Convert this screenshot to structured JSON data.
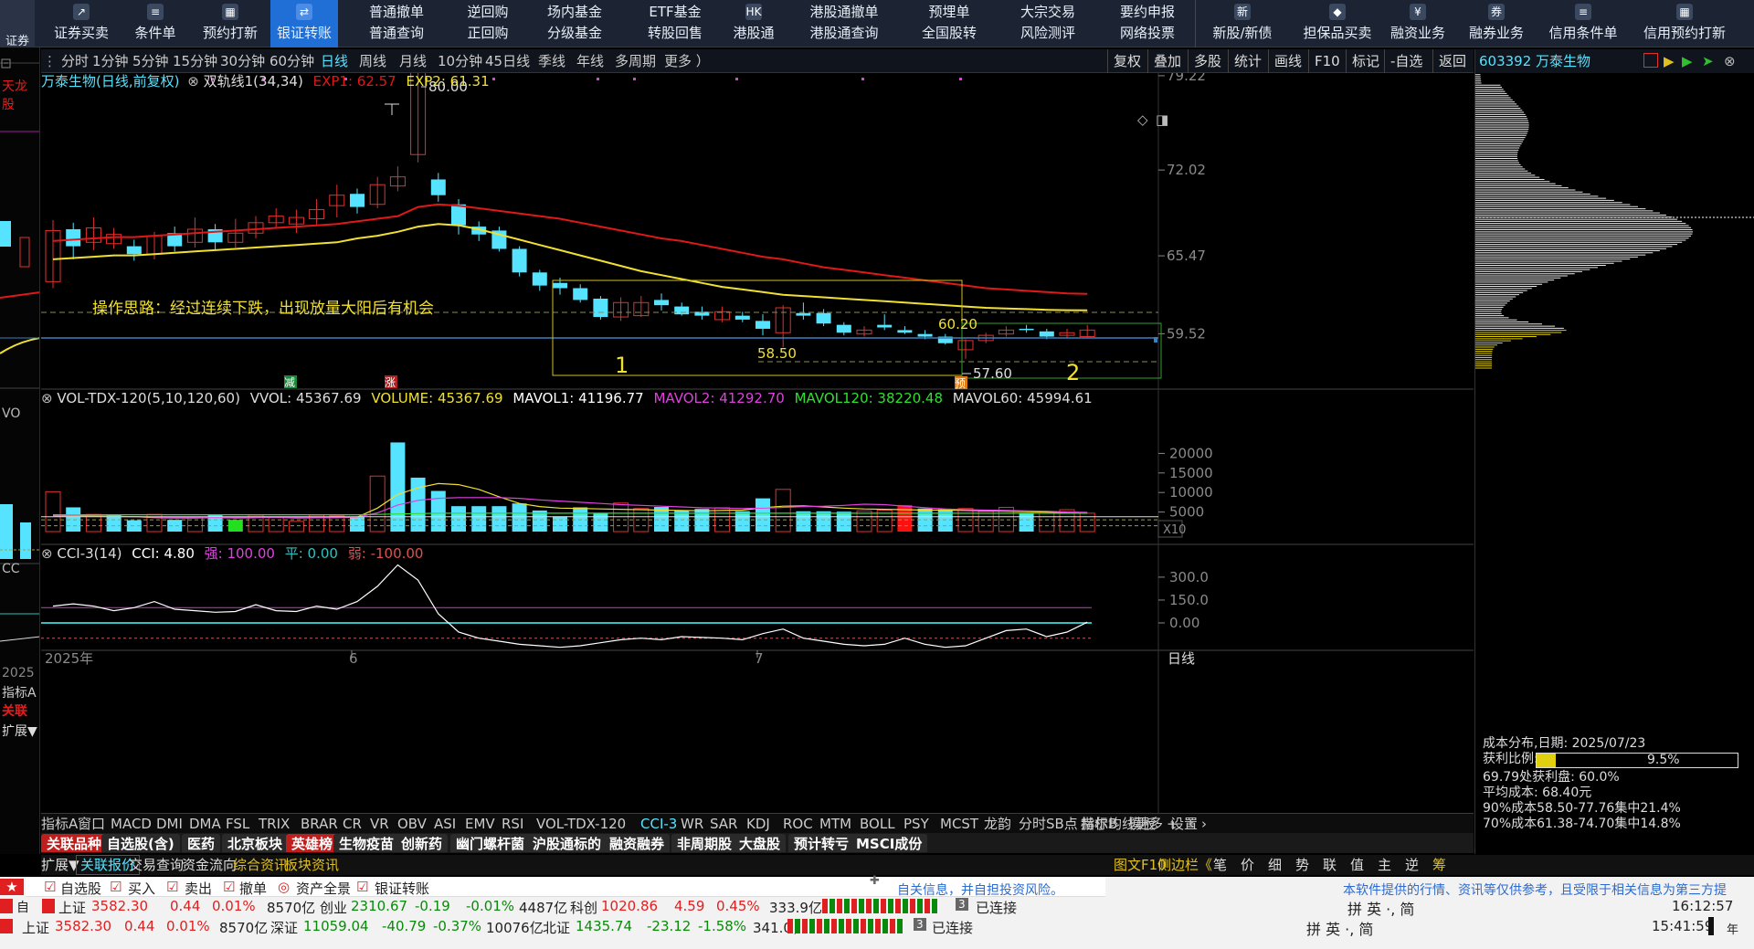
{
  "toolbar": {
    "left_buttons": [
      {
        "label": "证券买卖",
        "icon": "chart-icon"
      },
      {
        "label": "条件单",
        "icon": "order-icon"
      },
      {
        "label": "预约打新",
        "icon": "calendar-icon"
      },
      {
        "label": "银证转账",
        "icon": "transfer-icon"
      }
    ],
    "mid_pairs": [
      [
        "普通撤单",
        "普通查询"
      ],
      [
        "逆回购",
        "正回购"
      ],
      [
        "场内基金",
        "分级基金"
      ],
      [
        "ETF基金",
        "转股回售"
      ],
      [
        "港股通撤单",
        "港股通查询"
      ],
      [
        "预埋单",
        "全国股转"
      ],
      [
        "大宗交易",
        "风险测评"
      ],
      [
        "要约申报",
        "网络投票"
      ]
    ],
    "hk_label": "港股通",
    "right_buttons": [
      {
        "label": "新股/新债"
      },
      {
        "label": "担保品买卖"
      },
      {
        "label": "融资业务"
      },
      {
        "label": "融券业务"
      },
      {
        "label": "信用条件单"
      },
      {
        "label": "信用预约打新"
      }
    ]
  },
  "periods": [
    "分时",
    "1分钟",
    "5分钟",
    "15分钟",
    "30分钟",
    "60分钟",
    "日线",
    "周线",
    "月线",
    "10分钟",
    "45日线",
    "季线",
    "年线",
    "多周期",
    "更多 ）"
  ],
  "period_selected": "日线",
  "actions": [
    "复权",
    "叠加",
    "多股",
    "统计",
    "画线",
    "F10",
    "标记",
    "-自选",
    "返回"
  ],
  "left_strip": [
    "证券",
    "天龙股",
    "VO",
    "CC",
    "2025",
    "指标A",
    "关联",
    "扩展▼",
    "自"
  ],
  "main_chart": {
    "title": "万泰生物(日线,前复权)",
    "indicator": "双轨线1(34,34)",
    "exp1": "EXP1: 62.57",
    "exp2": "EXP2: 61.31",
    "y_ticks": [
      "79.22",
      "72.02",
      "65.47",
      "59.52"
    ],
    "annotation": "操作思路：经过连续下跌，出现放量大阳后有机会",
    "box1_label": "1",
    "box2_label": "2",
    "high_label": "80.00",
    "low_label": "57.60",
    "label_5850": "58.50",
    "label_6020": "60.20",
    "tag_jian": "减",
    "tag_zhang": "涨",
    "tag_yu": "预"
  },
  "volume_panel": {
    "title": "VOL-TDX-120(5,10,120,60)",
    "vvol": "VVOL: 45367.69",
    "volume": "VOLUME: 45367.69",
    "mavol1": "MAVOL1: 41196.77",
    "mavol2": "MAVOL2: 41292.70",
    "mavol120": "MAVOL120: 38220.48",
    "mavol60": "MAVOL60: 45994.61",
    "y_ticks": [
      "20000",
      "15000",
      "10000",
      "5000"
    ],
    "unit": "X10"
  },
  "cci_panel": {
    "title": "CCI-3(14)",
    "cci": "CCI: 4.80",
    "strong": "强: 100.00",
    "flat": "平: 0.00",
    "weak": "弱: -100.00",
    "y_ticks": [
      "300.0",
      "150.0",
      "0.00"
    ]
  },
  "date_axis": [
    "2025年",
    "6",
    "7"
  ],
  "date_axis_unit": "日线",
  "indicator_tabs": [
    "指标A",
    "窗口",
    "MACD",
    "DMI",
    "DMA",
    "FSL",
    "TRIX",
    "BRAR",
    "CR",
    "VR",
    "OBV",
    "ASI",
    "EMV",
    "RSI",
    "VOL-TDX-120",
    "CCI-3",
    "WR",
    "SAR",
    "KDJ",
    "ROC",
    "MTM",
    "BOLL",
    "PSY",
    "MCST",
    "龙韵",
    "分时SB点",
    "赫尔均线",
    "更多",
    "设置",
    "指标B",
    "模板"
  ],
  "indicator_selected": "CCI-3",
  "sector_tabs": [
    "关联品种",
    "自选股(含)",
    "医药",
    "北京板块",
    "英雄榜",
    "生物疫苗",
    "创新药",
    "幽门螺杆菌",
    "沪股通标的",
    "融资融券",
    "非周期股",
    "大盘股",
    "预计转亏",
    "MSCI成份"
  ],
  "footer_tabs": [
    "扩展▼",
    "关联报价",
    "交易查询",
    "资金流向",
    "综合资讯",
    "板块资讯"
  ],
  "footer_right": [
    "图文F10",
    "侧边栏《",
    "笔",
    "价",
    "细",
    "势",
    "联",
    "值",
    "主",
    "逆",
    "筹"
  ],
  "right_panel": {
    "code": "603392 万泰生物",
    "cost_date": "成本分布,日期: 2025/07/23",
    "profit_ratio_label": "获利比例:",
    "profit_ratio": "9.5%",
    "profit_line": "69.79处获利盘: 60.0%",
    "avg_cost": "平均成本: 68.40元",
    "cost90": "90%成本58.50-77.76集中21.4%",
    "cost70": "70%成本61.38-74.70集中14.8%",
    "profit_ratio_value": 0.095
  },
  "bottom": {
    "quick": [
      "自选股",
      "买入",
      "卖出",
      "撤单",
      "资产全景",
      "银证转账"
    ],
    "notice1": "自关信息，并自担投资风险。",
    "notice2": "本软件提供的行情、资讯等仅供参考，且受限于相关信息为第三方提",
    "idx_row1": {
      "sh": "上证",
      "sh_v": "3582.30",
      "sh_c": "0.44",
      "sh_p": "0.01%",
      "sh_a": "8570亿",
      "cy": "创业",
      "cy_v": "2310.67",
      "cy_c": "-0.19",
      "cy_p": "-0.01%",
      "cy_a": "4487亿",
      "kc": "科创",
      "kc_v": "1020.86",
      "kc_c": "4.59",
      "kc_p": "0.45%",
      "kc_a": "333.9亿"
    },
    "idx_row2": {
      "sh": "上证",
      "sh_v": "3582.30",
      "sh_c": "0.44",
      "sh_p": "0.01%",
      "sh_a": "8570亿",
      "sz": "深证",
      "sz_v": "11059.04",
      "sz_c": "-40.79",
      "sz_p": "-0.37%",
      "sz_a": "10076亿",
      "bz": "北证",
      "bz_v": "1435.74",
      "bz_c": "-23.12",
      "bz_p": "-1.58%",
      "bz_a": "341.0亿"
    },
    "conn": "已连接",
    "conn_n": "3",
    "time1": "16:12:57",
    "time2": "15:41:59",
    "ime": "拼 英 ·, 简",
    "nian": "年"
  },
  "colors": {
    "up": "#e0322f",
    "down": "#55e3ff",
    "exp1": "#e01818",
    "exp2": "#f0e030",
    "selected": "#1f6fd6"
  }
}
